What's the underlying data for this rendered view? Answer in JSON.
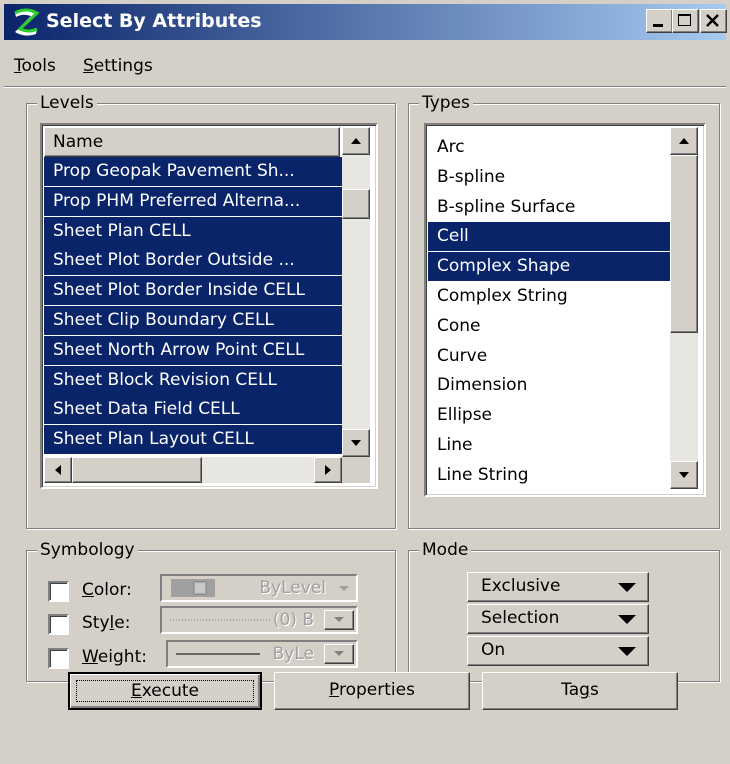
{
  "window": {
    "title": "Select By Attributes",
    "controls": [
      "minimize",
      "maximize",
      "close"
    ]
  },
  "menu": [
    {
      "label": "Tools",
      "access": "T",
      "rest": "ools"
    },
    {
      "label": "Settings",
      "access": "S",
      "rest": "ettings"
    }
  ],
  "levels": {
    "group_label": "Levels",
    "column_header": "Name",
    "items": [
      {
        "label": "Prop Geopak Pavement Sh...",
        "selected": true
      },
      {
        "label": "Prop PHM Preferred Alterna...",
        "selected": true
      },
      {
        "label": "Sheet Plan CELL",
        "selected": true
      },
      {
        "label": "Sheet Plot Border Outside ...",
        "selected": true
      },
      {
        "label": "Sheet Plot Border Inside CELL",
        "selected": true
      },
      {
        "label": "Sheet Clip Boundary CELL",
        "selected": true
      },
      {
        "label": "Sheet North Arrow Point CELL",
        "selected": true
      },
      {
        "label": "Sheet Block Revision CELL",
        "selected": true
      },
      {
        "label": "Sheet Data Field CELL",
        "selected": true
      },
      {
        "label": "Sheet Plan Layout CELL",
        "selected": true
      }
    ]
  },
  "types": {
    "group_label": "Types",
    "items": [
      {
        "label": "Arc",
        "selected": false
      },
      {
        "label": "B-spline",
        "selected": false
      },
      {
        "label": "B-spline Surface",
        "selected": false
      },
      {
        "label": "Cell",
        "selected": true
      },
      {
        "label": "Complex Shape",
        "selected": true
      },
      {
        "label": "Complex String",
        "selected": false
      },
      {
        "label": "Cone",
        "selected": false
      },
      {
        "label": "Curve",
        "selected": false
      },
      {
        "label": "Dimension",
        "selected": false
      },
      {
        "label": "Ellipse",
        "selected": false
      },
      {
        "label": "Line",
        "selected": false
      },
      {
        "label": "Line String",
        "selected": false
      }
    ]
  },
  "symbology": {
    "group_label": "Symbology",
    "color": {
      "access": "C",
      "rest": "olor:",
      "value": "ByLevel",
      "checked": false
    },
    "style": {
      "pre": "Sty",
      "access": "l",
      "rest": "e:",
      "value": "(0) B",
      "checked": false
    },
    "weight": {
      "access": "W",
      "rest": "eight:",
      "value": "ByLe",
      "checked": false
    }
  },
  "mode": {
    "group_label": "Mode",
    "options": [
      "Exclusive",
      "Selection",
      "On"
    ]
  },
  "buttons": {
    "execute": {
      "access": "E",
      "rest": "xecute"
    },
    "properties": {
      "access": "P",
      "rest": "roperties"
    },
    "tags": {
      "pre": "Ta",
      "access": "g",
      "rest": "s"
    }
  },
  "colors": {
    "face": "#d4d0c8",
    "selection": "#0a246a",
    "title_start": "#0a246a",
    "title_end": "#a6caf0"
  },
  "icons": [
    "app-z-icon",
    "minimize-icon",
    "maximize-icon",
    "close-icon",
    "scroll-up-arrow-icon",
    "scroll-down-arrow-icon",
    "scroll-left-arrow-icon",
    "scroll-right-arrow-icon",
    "dropdown-arrow-icon",
    "color-swatch-icon"
  ]
}
